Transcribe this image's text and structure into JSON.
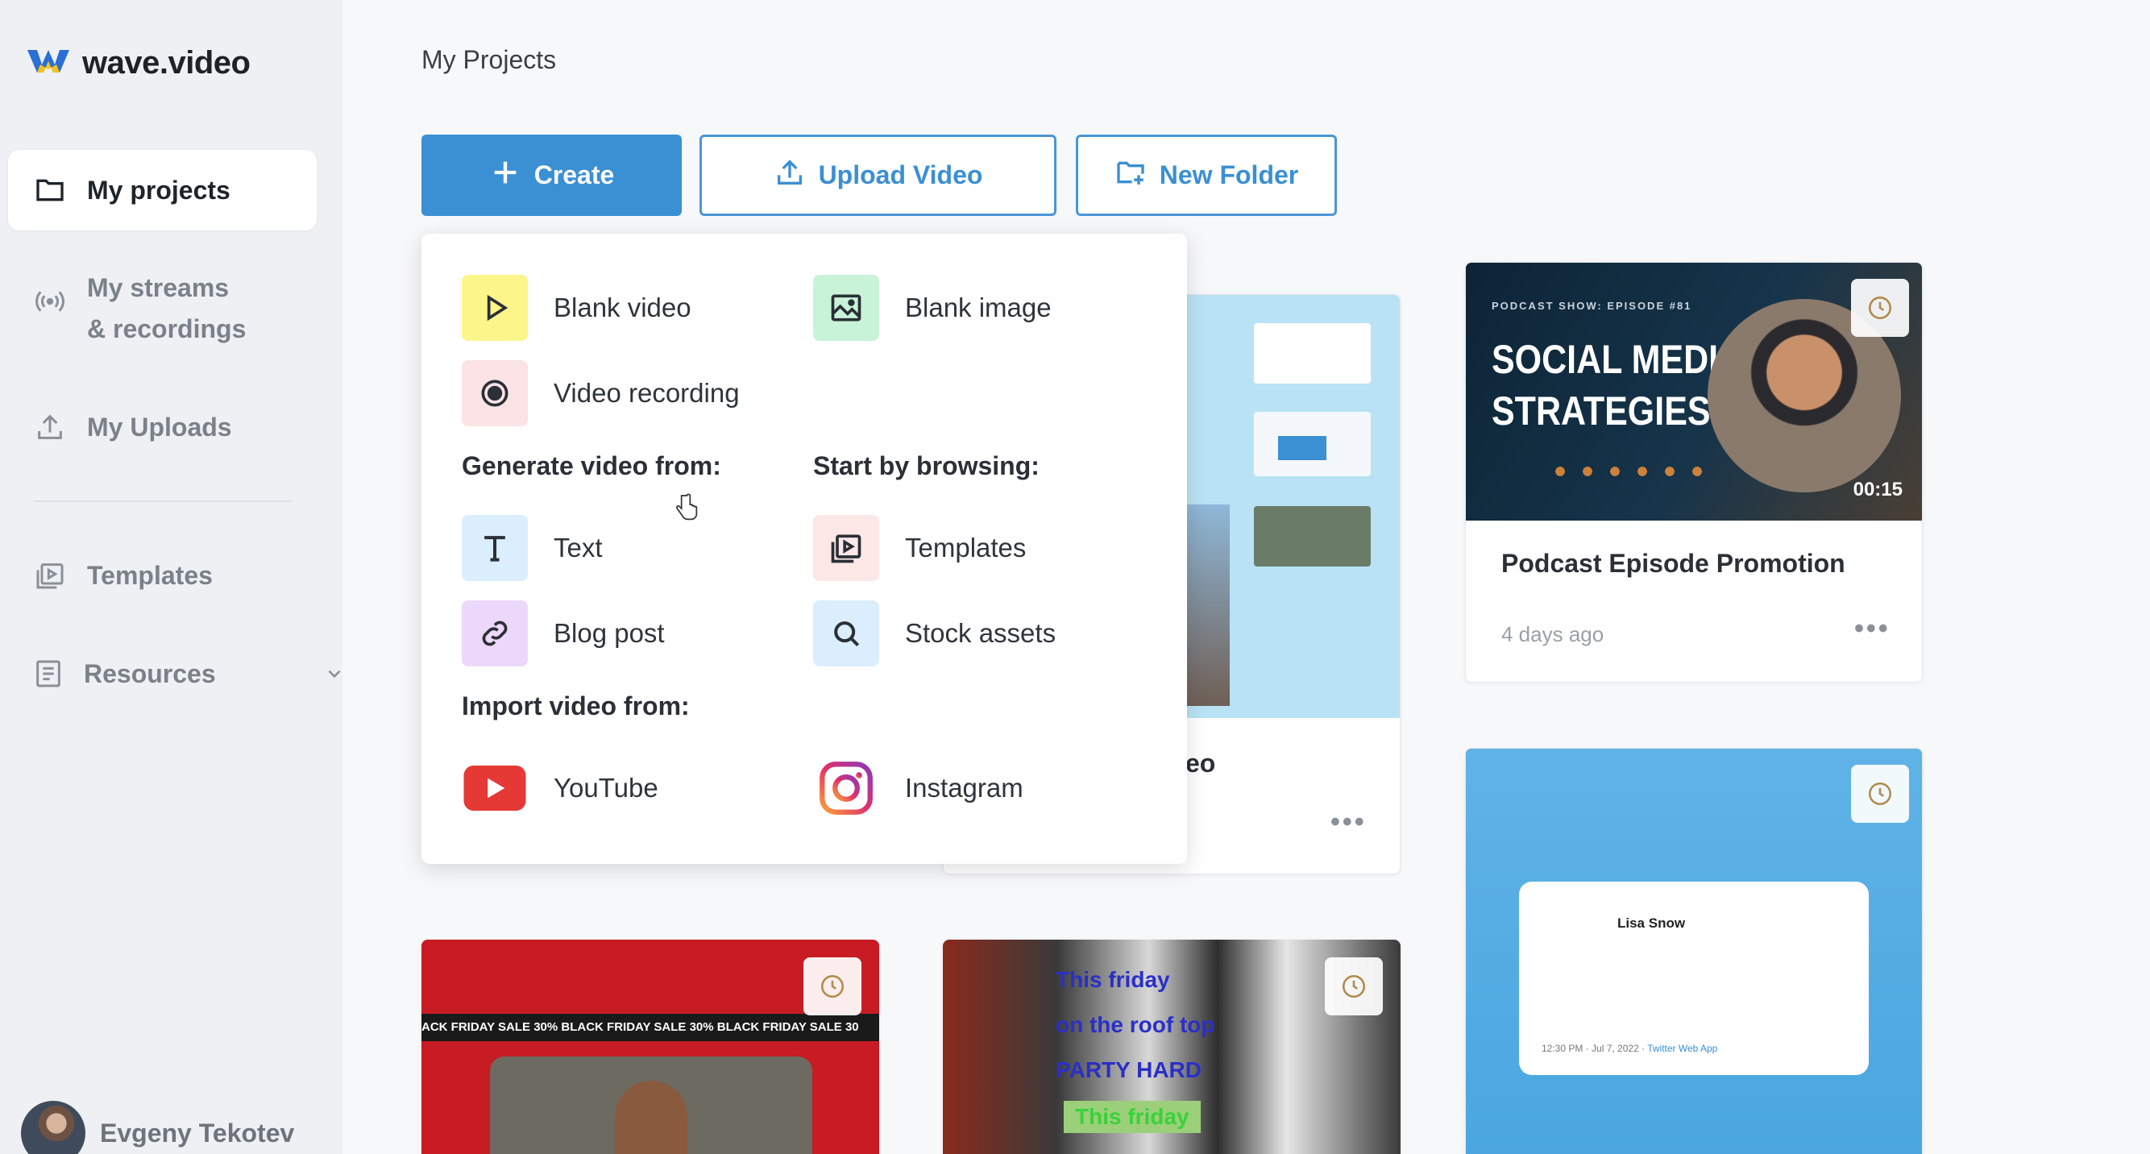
{
  "brand": {
    "name": "wave.video"
  },
  "sidebar": {
    "items": [
      {
        "label": "My projects",
        "active": true,
        "icon": "folder-icon"
      },
      {
        "label_line1": "My streams",
        "label_line2": "& recordings",
        "icon": "broadcast-icon"
      },
      {
        "label": "My Uploads",
        "icon": "upload-icon"
      },
      {
        "label": "Templates",
        "icon": "templates-icon"
      },
      {
        "label": "Resources",
        "icon": "resources-icon"
      }
    ],
    "user": {
      "name": "Evgeny Tekotev"
    }
  },
  "main": {
    "title": "My Projects",
    "buttons": {
      "create": "Create",
      "upload": "Upload Video",
      "folder": "New Folder"
    },
    "cards": [
      {
        "title": "Podcast Episode Promotion",
        "meta": "4 days ago",
        "thumb_kicker": "PODCAST SHOW: EPISODE #81",
        "thumb_line1": "SOCIAL MEDIA",
        "thumb_line2": "STRATEGIES",
        "duration": "00:15"
      },
      {
        "title_fragment": "eo"
      },
      {
        "thumb_name": "Lisa Snow",
        "thumb_footer": "12:30 PM · Jul 7, 2022 ·",
        "thumb_link": "Twitter Web App"
      },
      {
        "thumb_banner": "ACK FRIDAY SALE 30% BLACK FRIDAY SALE 30%   BLACK FRIDAY SALE 30"
      },
      {
        "thumb_line1": "This friday",
        "thumb_line2": "on the roof top",
        "thumb_line3": "PARTY HARD",
        "thumb_line4": "This friday"
      }
    ]
  },
  "menu": {
    "items": {
      "blank_video": "Blank video",
      "blank_image": "Blank image",
      "video_recording": "Video recording",
      "text": "Text",
      "blog_post": "Blog post",
      "templates": "Templates",
      "stock_assets": "Stock assets",
      "youtube": "YouTube",
      "instagram": "Instagram"
    },
    "headings": {
      "generate": "Generate video from:",
      "browse": "Start by browsing:",
      "import": "Import video from:"
    }
  },
  "colors": {
    "accent": "#3b8fd3",
    "sidebar_bg": "#eef0f3",
    "light_blue": "#b9e3f5"
  }
}
